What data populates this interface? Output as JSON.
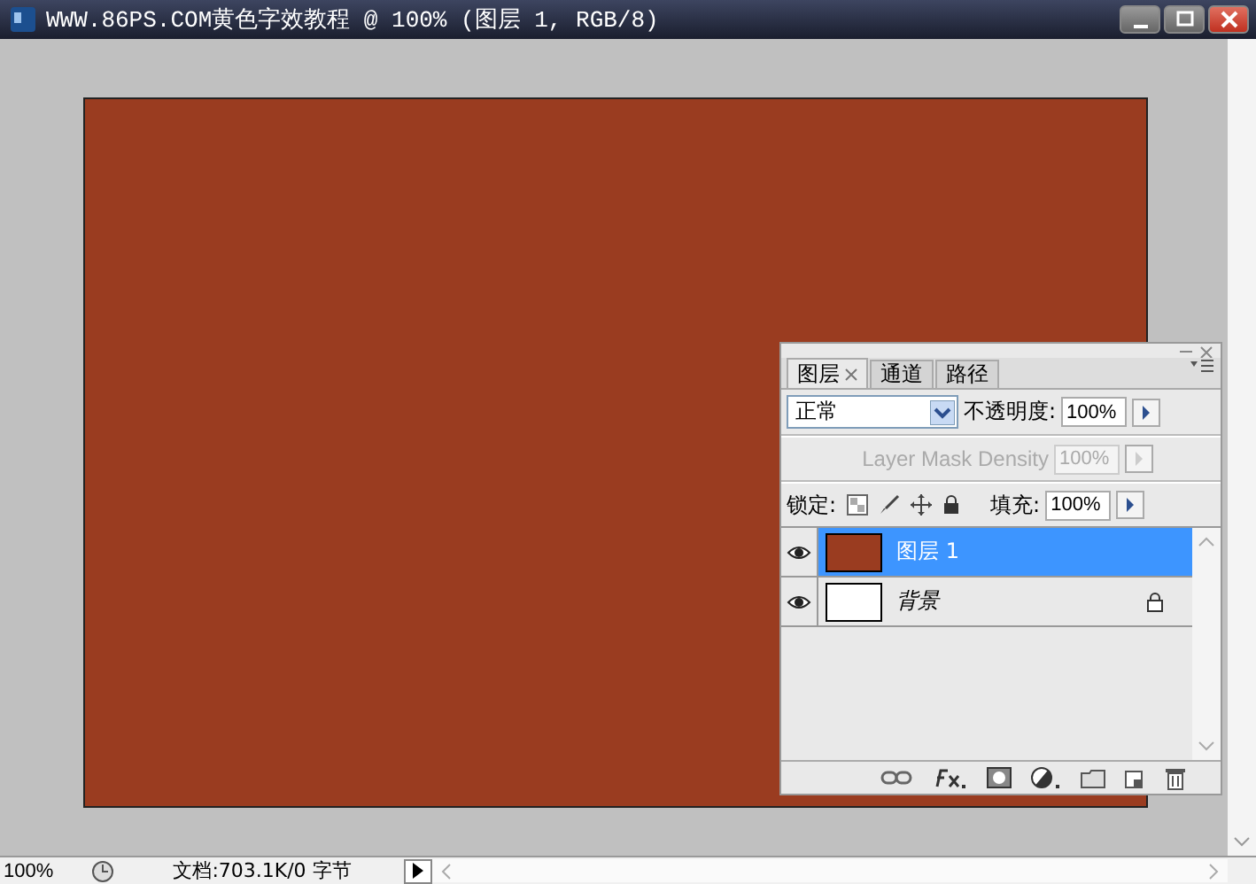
{
  "window": {
    "title": "WWW.86PS.COM黄色字效教程 @ 100% (图层 1, RGB/8)"
  },
  "panel": {
    "tabs": [
      {
        "label": "图层",
        "selected": true
      },
      {
        "label": "通道",
        "selected": false
      },
      {
        "label": "路径",
        "selected": false
      }
    ],
    "blend_mode": "正常",
    "opacity": {
      "label": "不透明度:",
      "value": "100%"
    },
    "mask_density": {
      "label": "Layer Mask Density",
      "value": "100%",
      "disabled": true
    },
    "lock": {
      "label": "锁定:"
    },
    "fill": {
      "label": "填充:",
      "value": "100%"
    },
    "layers": [
      {
        "name": "图层 1",
        "selected": true,
        "visible": true,
        "locked": false,
        "color": "#9a3c20"
      },
      {
        "name": "背景",
        "selected": false,
        "visible": true,
        "locked": true,
        "color": "#ffffff"
      }
    ]
  },
  "status_bar": {
    "zoom": "100%",
    "doc_info": "文档:703.1K/0 字节"
  }
}
